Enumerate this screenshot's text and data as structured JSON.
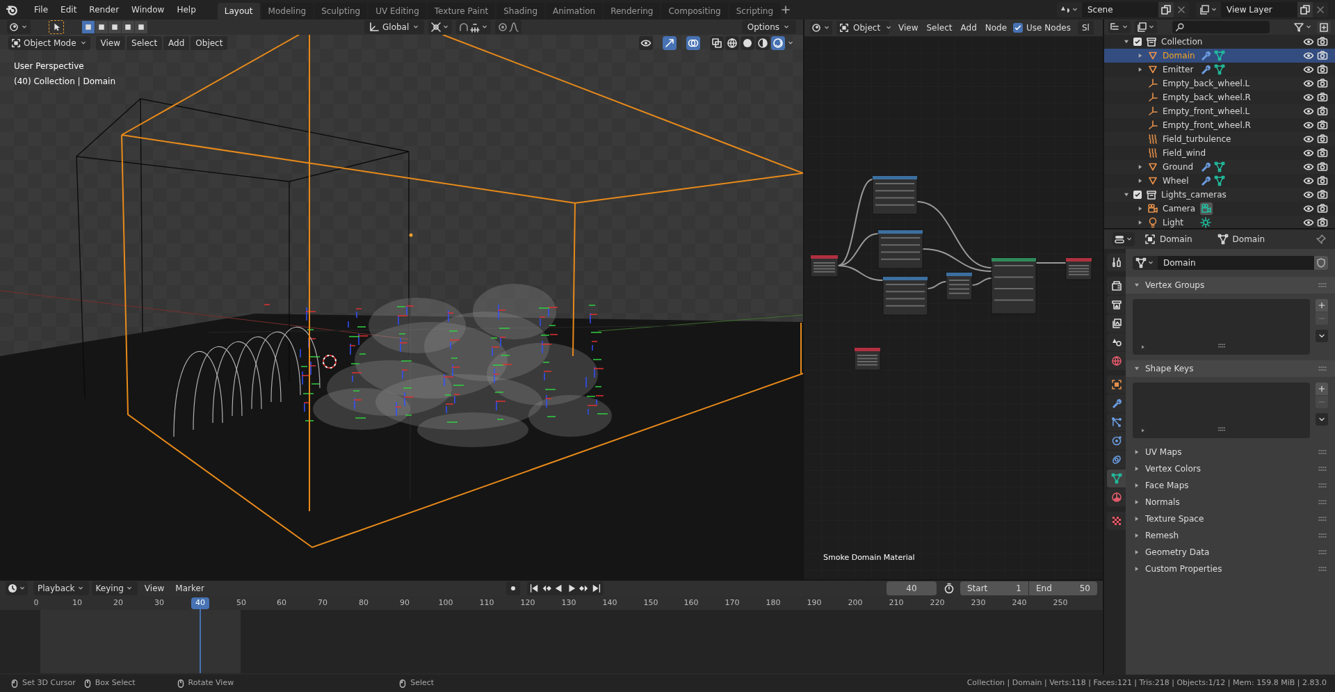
{
  "menu": [
    "File",
    "Edit",
    "Render",
    "Window",
    "Help"
  ],
  "workspaces": [
    {
      "label": "Layout",
      "selected": true
    },
    {
      "label": "Modeling",
      "selected": false
    },
    {
      "label": "Sculpting",
      "selected": false
    },
    {
      "label": "UV Editing",
      "selected": false
    },
    {
      "label": "Texture Paint",
      "selected": false
    },
    {
      "label": "Shading",
      "selected": false
    },
    {
      "label": "Animation",
      "selected": false
    },
    {
      "label": "Rendering",
      "selected": false
    },
    {
      "label": "Compositing",
      "selected": false
    },
    {
      "label": "Scripting",
      "selected": false
    }
  ],
  "scene": "Scene",
  "view_layer": "View Layer",
  "viewport": {
    "orientation": "Global",
    "options": "Options",
    "mode": "Object Mode",
    "menus": [
      "View",
      "Select",
      "Add",
      "Object"
    ],
    "overlay_lines": [
      "User Perspective",
      "(40) Collection | Domain"
    ]
  },
  "node_editor": {
    "type": "Object",
    "menus": [
      "View",
      "Select",
      "Add",
      "Node"
    ],
    "use_nodes": true,
    "use_nodes_label": "Use Nodes",
    "slot_label": "Sl",
    "material_name": "Smoke Domain Material"
  },
  "outliner": [
    {
      "name": "Collection",
      "kind": "collection",
      "checked": true,
      "expanded": true,
      "selected": false,
      "children": [
        {
          "name": "Domain",
          "kind": "mesh",
          "selected": true,
          "expanded": false,
          "extras": [
            {
              "kind": "modifier"
            },
            {
              "kind": "mesh"
            }
          ]
        },
        {
          "name": "Emitter",
          "kind": "mesh",
          "selected": false,
          "expanded": false,
          "extras": [
            {
              "kind": "modifier"
            },
            {
              "kind": "mesh"
            }
          ]
        },
        {
          "name": "Empty_back_wheel.L",
          "kind": "empty",
          "selected": false
        },
        {
          "name": "Empty_back_wheel.R",
          "kind": "empty",
          "selected": false
        },
        {
          "name": "Empty_front_wheel.L",
          "kind": "empty",
          "selected": false
        },
        {
          "name": "Empty_front_wheel.R",
          "kind": "empty",
          "selected": false
        },
        {
          "name": "Field_turbulence",
          "kind": "force",
          "selected": false
        },
        {
          "name": "Field_wind",
          "kind": "force",
          "selected": false
        },
        {
          "name": "Ground",
          "kind": "mesh",
          "selected": false,
          "expanded": false,
          "extras": [
            {
              "kind": "modifier"
            },
            {
              "kind": "mesh"
            }
          ]
        },
        {
          "name": "Wheel",
          "kind": "mesh",
          "selected": false,
          "expanded": false,
          "extras": [
            {
              "kind": "modifier"
            },
            {
              "kind": "mesh"
            }
          ]
        }
      ]
    },
    {
      "name": "Lights_cameras",
      "kind": "collection",
      "checked": true,
      "expanded": true,
      "selected": false,
      "children": [
        {
          "name": "Camera",
          "kind": "camera",
          "selected": false,
          "expanded": false,
          "extras": [
            {
              "kind": "camera"
            }
          ]
        },
        {
          "name": "Light",
          "kind": "light",
          "selected": false,
          "expanded": false,
          "extras": [
            {
              "kind": "light"
            }
          ]
        }
      ]
    }
  ],
  "properties": {
    "object": "Domain",
    "data": "Domain",
    "datablock": "Domain",
    "tabs": [
      {
        "kind": "tool",
        "selected": false
      },
      {
        "kind": "render",
        "selected": false
      },
      {
        "kind": "output",
        "selected": false
      },
      {
        "kind": "view_layer",
        "selected": false
      },
      {
        "kind": "scene",
        "selected": false
      },
      {
        "kind": "world",
        "selected": false
      },
      {
        "kind": "object",
        "selected": false
      },
      {
        "kind": "modifiers",
        "selected": false
      },
      {
        "kind": "particles",
        "selected": false
      },
      {
        "kind": "physics",
        "selected": false
      },
      {
        "kind": "constraints",
        "selected": false
      },
      {
        "kind": "data",
        "selected": true
      },
      {
        "kind": "material",
        "selected": false
      },
      {
        "kind": "texture",
        "selected": false
      }
    ],
    "panels": [
      {
        "title": "Vertex Groups",
        "expanded": true
      },
      {
        "title": "Shape Keys",
        "expanded": true
      },
      {
        "title": "UV Maps",
        "expanded": false
      },
      {
        "title": "Vertex Colors",
        "expanded": false
      },
      {
        "title": "Face Maps",
        "expanded": false
      },
      {
        "title": "Normals",
        "expanded": false
      },
      {
        "title": "Texture Space",
        "expanded": false
      },
      {
        "title": "Remesh",
        "expanded": false
      },
      {
        "title": "Geometry Data",
        "expanded": false
      },
      {
        "title": "Custom Properties",
        "expanded": false
      }
    ]
  },
  "timeline": {
    "menus": [
      {
        "label": "Playback",
        "dropdown": true
      },
      {
        "label": "Keying",
        "dropdown": true
      },
      {
        "label": "View",
        "dropdown": false
      },
      {
        "label": "Marker",
        "dropdown": false
      }
    ],
    "current_frame": "40",
    "start_label": "Start",
    "start": "1",
    "end_label": "End",
    "end": "50",
    "ruler": [
      {
        "label": "0",
        "selected": false
      },
      {
        "label": "10",
        "selected": false
      },
      {
        "label": "20",
        "selected": false
      },
      {
        "label": "30",
        "selected": false
      },
      {
        "label": "40",
        "selected": true
      },
      {
        "label": "50",
        "selected": false
      },
      {
        "label": "60",
        "selected": false
      },
      {
        "label": "70",
        "selected": false
      },
      {
        "label": "80",
        "selected": false
      },
      {
        "label": "90",
        "selected": false
      },
      {
        "label": "100",
        "selected": false
      },
      {
        "label": "110",
        "selected": false
      },
      {
        "label": "120",
        "selected": false
      },
      {
        "label": "130",
        "selected": false
      },
      {
        "label": "140",
        "selected": false
      },
      {
        "label": "150",
        "selected": false
      },
      {
        "label": "160",
        "selected": false
      },
      {
        "label": "170",
        "selected": false
      },
      {
        "label": "180",
        "selected": false
      },
      {
        "label": "190",
        "selected": false
      },
      {
        "label": "200",
        "selected": false
      },
      {
        "label": "210",
        "selected": false
      },
      {
        "label": "220",
        "selected": false
      },
      {
        "label": "230",
        "selected": false
      },
      {
        "label": "240",
        "selected": false
      },
      {
        "label": "250",
        "selected": false
      }
    ]
  },
  "status_bar": {
    "hints": [
      {
        "kind": "left",
        "label": "Set 3D Cursor"
      },
      {
        "kind": "middle",
        "label": "Box Select"
      },
      {
        "kind": "middle",
        "label": "Rotate View"
      },
      {
        "kind": "left",
        "label": "Select"
      }
    ],
    "info": "Collection | Domain | Verts:118 | Faces:121 | Tris:218 | Objects:1/12 | Mem: 159.8 MiB | 2.83.0"
  }
}
